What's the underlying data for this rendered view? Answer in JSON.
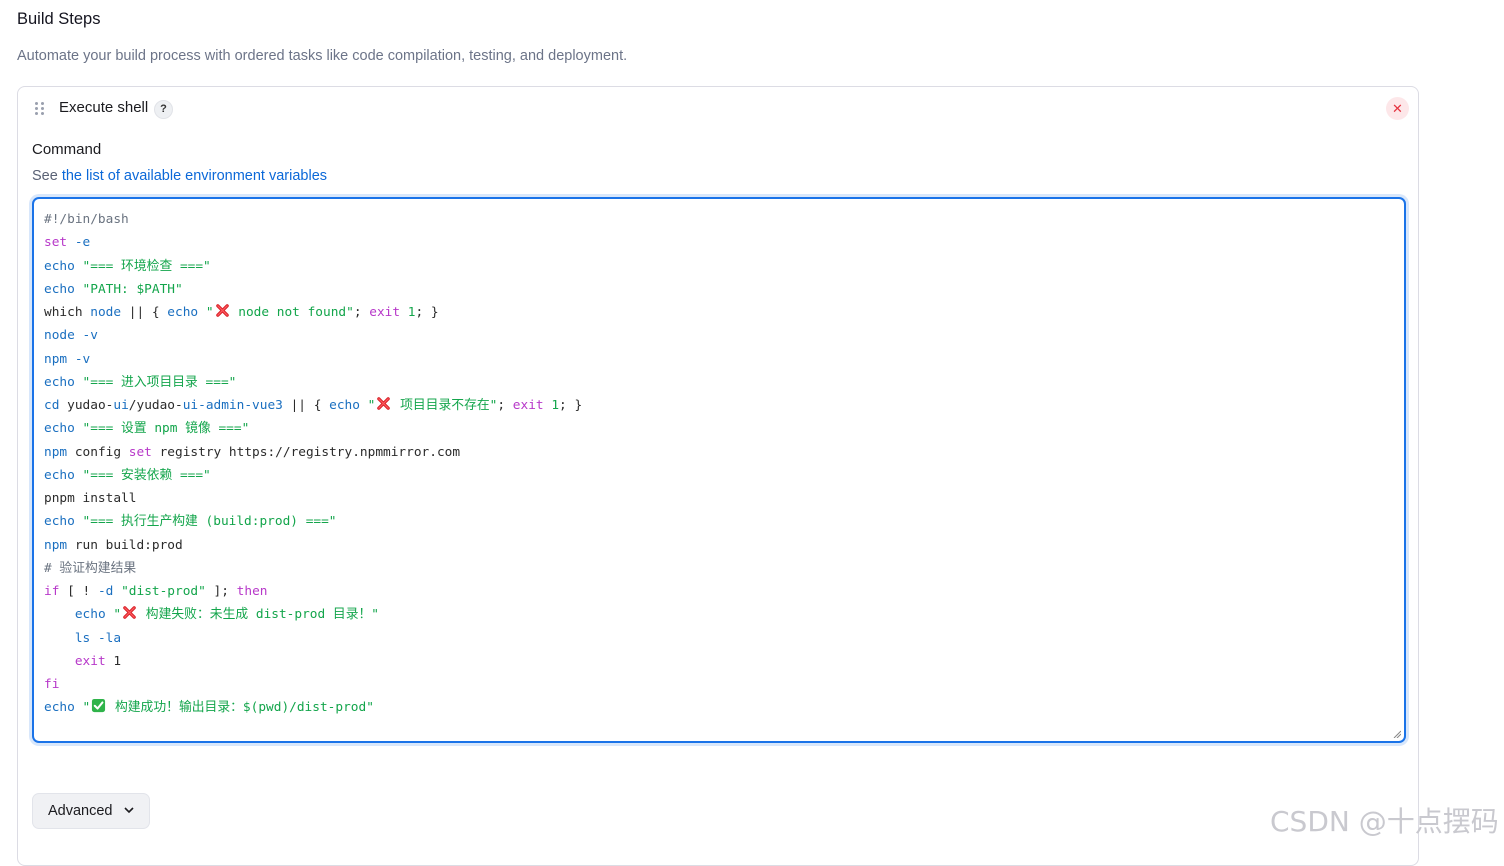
{
  "section": {
    "title": "Build Steps",
    "description": "Automate your build process with ordered tasks like code compilation, testing, and deployment."
  },
  "step": {
    "title": "Execute shell",
    "help_label": "?",
    "close_label": "✕",
    "command_label": "Command",
    "env_prefix": "See ",
    "env_link": "the list of available environment variables"
  },
  "advanced": {
    "label": "Advanced"
  },
  "code_lines": [
    [
      {
        "t": "#!/bin/bash",
        "c": "cm"
      }
    ],
    [
      {
        "t": "set",
        "c": "kw"
      },
      {
        "t": " -e",
        "c": "bi"
      }
    ],
    [
      {
        "t": "echo",
        "c": "bi"
      },
      {
        "t": " \"=== 环境检查 ===\"",
        "c": "str"
      }
    ],
    [
      {
        "t": "echo",
        "c": "bi"
      },
      {
        "t": " \"PATH: $PATH\"",
        "c": "str"
      }
    ],
    [
      {
        "t": "which ",
        "c": "pl"
      },
      {
        "t": "node",
        "c": "bi"
      },
      {
        "t": " || { ",
        "c": "pl"
      },
      {
        "t": "echo",
        "c": "bi"
      },
      {
        "t": " \"",
        "c": "str"
      },
      {
        "icon": "cross-mark"
      },
      {
        "t": " node not found\"",
        "c": "str"
      },
      {
        "t": "; ",
        "c": "pl"
      },
      {
        "t": "exit",
        "c": "kw"
      },
      {
        "t": " 1",
        "c": "str"
      },
      {
        "t": "; }",
        "c": "pl"
      }
    ],
    [
      {
        "t": "node -v",
        "c": "bi"
      }
    ],
    [
      {
        "t": "npm -v",
        "c": "bi"
      }
    ],
    [
      {
        "t": "echo",
        "c": "bi"
      },
      {
        "t": " \"=== 进入项目目录 ===\"",
        "c": "str"
      }
    ],
    [
      {
        "t": "cd",
        "c": "bi"
      },
      {
        "t": " yudao-",
        "c": "pl"
      },
      {
        "t": "ui",
        "c": "bi"
      },
      {
        "t": "/yudao-",
        "c": "pl"
      },
      {
        "t": "ui-admin-vue3",
        "c": "bi"
      },
      {
        "t": " || { ",
        "c": "pl"
      },
      {
        "t": "echo",
        "c": "bi"
      },
      {
        "t": " \"",
        "c": "str"
      },
      {
        "icon": "cross-mark"
      },
      {
        "t": " 项目目录不存在\"",
        "c": "str"
      },
      {
        "t": "; ",
        "c": "pl"
      },
      {
        "t": "exit",
        "c": "kw"
      },
      {
        "t": " 1",
        "c": "str"
      },
      {
        "t": "; }",
        "c": "pl"
      }
    ],
    [
      {
        "t": "echo",
        "c": "bi"
      },
      {
        "t": " \"=== 设置 npm 镜像 ===\"",
        "c": "str"
      }
    ],
    [
      {
        "t": "npm",
        "c": "bi"
      },
      {
        "t": " config ",
        "c": "pl"
      },
      {
        "t": "set",
        "c": "kw"
      },
      {
        "t": " registry https://registry.npmmirror.com",
        "c": "pl"
      }
    ],
    [
      {
        "t": "echo",
        "c": "bi"
      },
      {
        "t": " \"=== 安装依赖 ===\"",
        "c": "str"
      }
    ],
    [
      {
        "t": "pnpm install",
        "c": "pl"
      }
    ],
    [
      {
        "t": "echo",
        "c": "bi"
      },
      {
        "t": " \"=== 执行生产构建 (build:prod) ===\"",
        "c": "str"
      }
    ],
    [
      {
        "t": "npm",
        "c": "bi"
      },
      {
        "t": " run build:prod",
        "c": "pl"
      }
    ],
    [
      {
        "t": "# 验证构建结果",
        "c": "cm"
      }
    ],
    [
      {
        "t": "if",
        "c": "kw"
      },
      {
        "t": " [ ! ",
        "c": "pl"
      },
      {
        "t": "-d",
        "c": "bi"
      },
      {
        "t": " \"dist-prod\"",
        "c": "str"
      },
      {
        "t": " ]; ",
        "c": "pl"
      },
      {
        "t": "then",
        "c": "kw"
      }
    ],
    [
      {
        "t": "    ",
        "c": "pl"
      },
      {
        "t": "echo",
        "c": "bi"
      },
      {
        "t": " \"",
        "c": "str"
      },
      {
        "icon": "cross-mark"
      },
      {
        "t": " 构建失败：未生成 dist-prod 目录！\"",
        "c": "str"
      }
    ],
    [
      {
        "t": "    ",
        "c": "pl"
      },
      {
        "t": "ls -la",
        "c": "bi"
      }
    ],
    [
      {
        "t": "    ",
        "c": "pl"
      },
      {
        "t": "exit",
        "c": "kw"
      },
      {
        "t": " 1",
        "c": "pl"
      }
    ],
    [
      {
        "t": "fi",
        "c": "kw"
      }
    ],
    [
      {
        "t": "echo",
        "c": "bi"
      },
      {
        "t": " \"",
        "c": "str"
      },
      {
        "icon": "check-mark"
      },
      {
        "t": " 构建成功！输出目录：$(pwd)/dist-prod\"",
        "c": "str"
      }
    ]
  ],
  "watermark": "CSDN @十点摆码",
  "colors": {
    "accent": "#1a73e8",
    "link": "#0b68d8",
    "string": "#13a54b",
    "builtin": "#1a6fc0",
    "keyword": "#b738c9",
    "danger": "#e5323f"
  }
}
